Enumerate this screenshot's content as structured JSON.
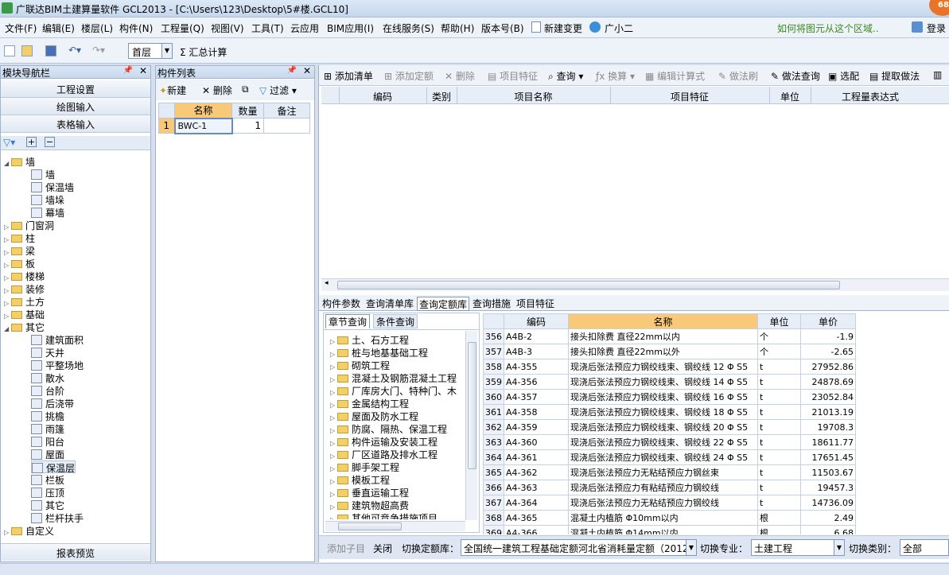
{
  "window": {
    "title": "广联达BIM土建算量软件 GCL2013 - [C:\\Users\\123\\Desktop\\5#楼.GCL10]",
    "badge": "68"
  },
  "menu": {
    "items": [
      "文件(F)",
      "编辑(E)",
      "楼层(L)",
      "构件(N)",
      "工程量(Q)",
      "视图(V)",
      "工具(T)",
      "云应用",
      "BIM应用(I)",
      "在线服务(S)",
      "帮助(H)",
      "版本号(B)",
      "新建变更",
      "广小二"
    ],
    "help": "如何将图元从这个区域..",
    "login": "登录"
  },
  "toolbar": {
    "floor": "首层",
    "sum": "汇总计算"
  },
  "nav": {
    "title": "模块导航栏",
    "buttons": [
      "工程设置",
      "绘图输入",
      "表格输入"
    ],
    "report": "报表预览",
    "wall": "墙",
    "wall_items": [
      "墙",
      "保温墙",
      "墙垛",
      "幕墙"
    ],
    "groups": [
      "门窗洞",
      "柱",
      "梁",
      "板",
      "楼梯",
      "装修",
      "土方",
      "基础"
    ],
    "other": "其它",
    "other_items": [
      "建筑面积",
      "天井",
      "平整场地",
      "散水",
      "台阶",
      "后浇带",
      "挑檐",
      "雨篷",
      "阳台",
      "屋面",
      "保温层",
      "栏板",
      "压顶",
      "其它",
      "栏杆扶手"
    ],
    "custom": "自定义"
  },
  "comp": {
    "title": "构件列表",
    "new": "新建",
    "delete": "删除",
    "filter": "过滤",
    "headers": [
      "名称",
      "数量",
      "备注"
    ],
    "row": {
      "no": "1",
      "name": "BWC-1",
      "qty": "1",
      "note": ""
    }
  },
  "right": {
    "tools": [
      "添加清单",
      "添加定额",
      "删除",
      "项目特征",
      "查询",
      "换算",
      "编辑计算式",
      "做法刷",
      "做法查询",
      "选配",
      "提取做法"
    ],
    "headers": [
      "编码",
      "类别",
      "项目名称",
      "项目特征",
      "单位",
      "工程量表达式"
    ],
    "tabs": [
      "构件参数",
      "查询清单库",
      "查询定额库",
      "查询措施",
      "项目特征"
    ],
    "chap_tabs": [
      "章节查询",
      "条件查询"
    ],
    "chapters": [
      "土、石方工程",
      "桩与地基基础工程",
      "砌筑工程",
      "混凝土及钢筋混凝土工程",
      "厂库房大门、特种门、木",
      "金属结构工程",
      "屋面及防水工程",
      "防腐、隔热、保温工程",
      "构件运输及安装工程",
      "厂区道路及排水工程",
      "脚手架工程",
      "模板工程",
      "垂直运输工程",
      "建筑物超高费",
      "其他可竞争措施项目"
    ],
    "qheaders": [
      "编码",
      "名称",
      "单位",
      "单价"
    ],
    "rows": [
      [
        "356",
        "A4B-2",
        "接头扣除费 直径22mm以内",
        "个",
        "-1.9"
      ],
      [
        "357",
        "A4B-3",
        "接头扣除费 直径22mm以外",
        "个",
        "-2.65"
      ],
      [
        "358",
        "A4-355",
        "现浇后张法预应力钢绞线束、钢绞线 12 Φ S5",
        "t",
        "27952.86"
      ],
      [
        "359",
        "A4-356",
        "现浇后张法预应力钢绞线束、钢绞线 14 Φ S5",
        "t",
        "24878.69"
      ],
      [
        "360",
        "A4-357",
        "现浇后张法预应力钢绞线束、钢绞线 16 Φ S5",
        "t",
        "23052.84"
      ],
      [
        "361",
        "A4-358",
        "现浇后张法预应力钢绞线束、钢绞线 18 Φ S5",
        "t",
        "21013.19"
      ],
      [
        "362",
        "A4-359",
        "现浇后张法预应力钢绞线束、钢绞线 20 Φ S5",
        "t",
        "19708.3"
      ],
      [
        "363",
        "A4-360",
        "现浇后张法预应力钢绞线束、钢绞线 22 Φ S5",
        "t",
        "18611.77"
      ],
      [
        "364",
        "A4-361",
        "现浇后张法预应力钢绞线束、钢绞线 24 Φ S5",
        "t",
        "17651.45"
      ],
      [
        "365",
        "A4-362",
        "现浇后张法预应力无粘结预应力钢丝束",
        "t",
        "11503.67"
      ],
      [
        "366",
        "A4-363",
        "现浇后张法预应力有粘结预应力钢绞线",
        "t",
        "19457.3"
      ],
      [
        "367",
        "A4-364",
        "现浇后张法预应力无粘结预应力钢绞线",
        "t",
        "14736.09"
      ],
      [
        "368",
        "A4-365",
        "混凝土内植筋 Φ10mm以内",
        "根",
        "2.49"
      ],
      [
        "369",
        "A4-366",
        "混凝土内植筋 Φ14mm以内",
        "根",
        "6.68"
      ]
    ],
    "bottom": {
      "add_child": "添加子目",
      "close": "关闭",
      "switch_lib": "切换定额库：",
      "lib": "全国统一建筑工程基础定额河北省消耗量定额（2012）",
      "switch_major": "切换专业：",
      "major": "土建工程",
      "switch_cat": "切换类别：",
      "cat": "全部"
    }
  }
}
